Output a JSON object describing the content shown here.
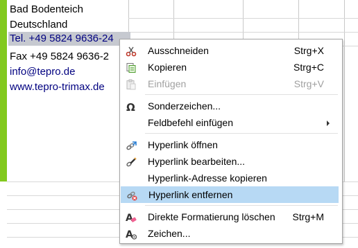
{
  "cells": {
    "row1": "Bad Bodenteich",
    "row2": "Deutschland",
    "row3": "Tel. +49 5824 9636-24",
    "row4": "Fax +49 5824 9636-2",
    "row5": "info@tepro.de",
    "row6": "www.tepro-trimax.de"
  },
  "menu": {
    "items": [
      {
        "label": "Ausschneiden",
        "shortcut": "Strg+X",
        "icon": "scissors-icon",
        "enabled": true
      },
      {
        "label": "Kopieren",
        "shortcut": "Strg+C",
        "icon": "copy-icon",
        "enabled": true
      },
      {
        "label": "Einfügen",
        "shortcut": "Strg+V",
        "icon": "paste-icon",
        "enabled": false
      },
      {
        "label": "Sonderzeichen...",
        "shortcut": "",
        "icon": "omega-icon",
        "enabled": true
      },
      {
        "label": "Feldbefehl einfügen",
        "shortcut": "",
        "icon": "",
        "enabled": true,
        "submenu": true
      },
      {
        "label": "Hyperlink öffnen",
        "shortcut": "",
        "icon": "hyperlink-open-icon",
        "enabled": true
      },
      {
        "label": "Hyperlink bearbeiten...",
        "shortcut": "",
        "icon": "hyperlink-edit-icon",
        "enabled": true
      },
      {
        "label": "Hyperlink-Adresse kopieren",
        "shortcut": "",
        "icon": "",
        "enabled": true
      },
      {
        "label": "Hyperlink entfernen",
        "shortcut": "",
        "icon": "hyperlink-remove-icon",
        "enabled": true,
        "highlighted": true
      },
      {
        "label": "Direkte Formatierung löschen",
        "shortcut": "Strg+M",
        "icon": "clear-format-icon",
        "enabled": true
      },
      {
        "label": "Zeichen...",
        "shortcut": "",
        "icon": "character-icon",
        "enabled": true
      }
    ]
  },
  "colors": {
    "accent_green": "#82c91e",
    "highlight": "#b7d9f4",
    "link": "#000080",
    "selection": "#c6c9d0"
  }
}
